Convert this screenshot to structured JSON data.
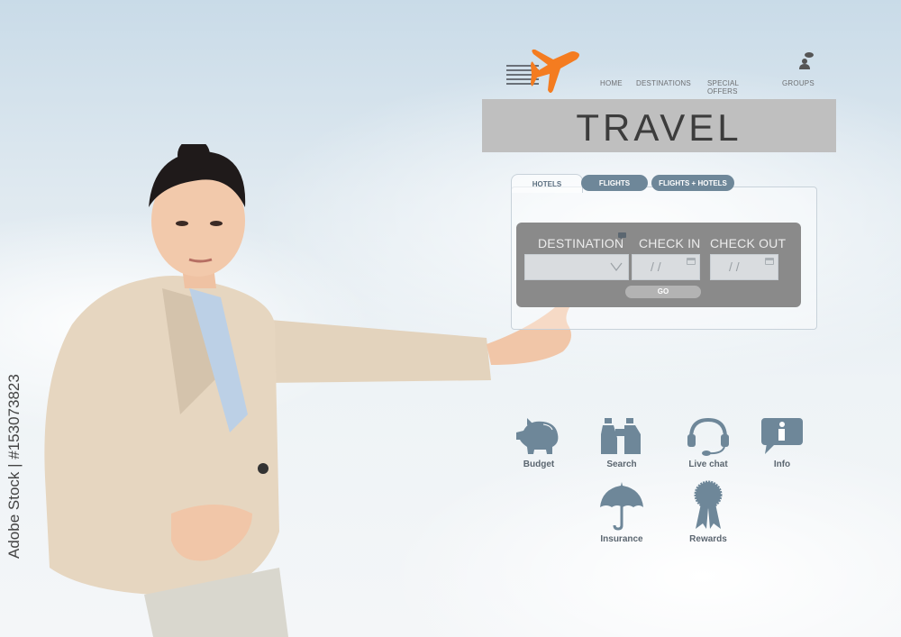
{
  "header": {
    "logo": "airplane-logo",
    "nav": [
      "HOME",
      "DESTINATIONS",
      "SPECIAL OFFERS",
      "GROUPS"
    ],
    "user_icon": "user-chat-icon"
  },
  "banner": {
    "title": "TRAVEL"
  },
  "booking": {
    "tabs": [
      "HOTELS",
      "FLIGHTS",
      "FLIGHTS + HOTELS"
    ],
    "active_tab": "HOTELS",
    "fields": {
      "destination_label": "DESTINATION",
      "checkin_label": "CHECK IN",
      "checkout_label": "CHECK OUT",
      "date_placeholder": "/ /"
    },
    "go_label": "GO"
  },
  "features": [
    {
      "label": "Budget",
      "icon": "piggy-bank-icon"
    },
    {
      "label": "Search",
      "icon": "binoculars-icon"
    },
    {
      "label": "Live chat",
      "icon": "headset-icon"
    },
    {
      "label": "Info",
      "icon": "info-bubble-icon"
    },
    {
      "label": "Insurance",
      "icon": "umbrella-icon"
    },
    {
      "label": "Rewards",
      "icon": "ribbon-icon"
    }
  ],
  "colors": {
    "accent": "#f47c20",
    "icon": "#6e8799",
    "banner": "#bfbfbf"
  },
  "stock_id": "Adobe Stock | #153073823"
}
